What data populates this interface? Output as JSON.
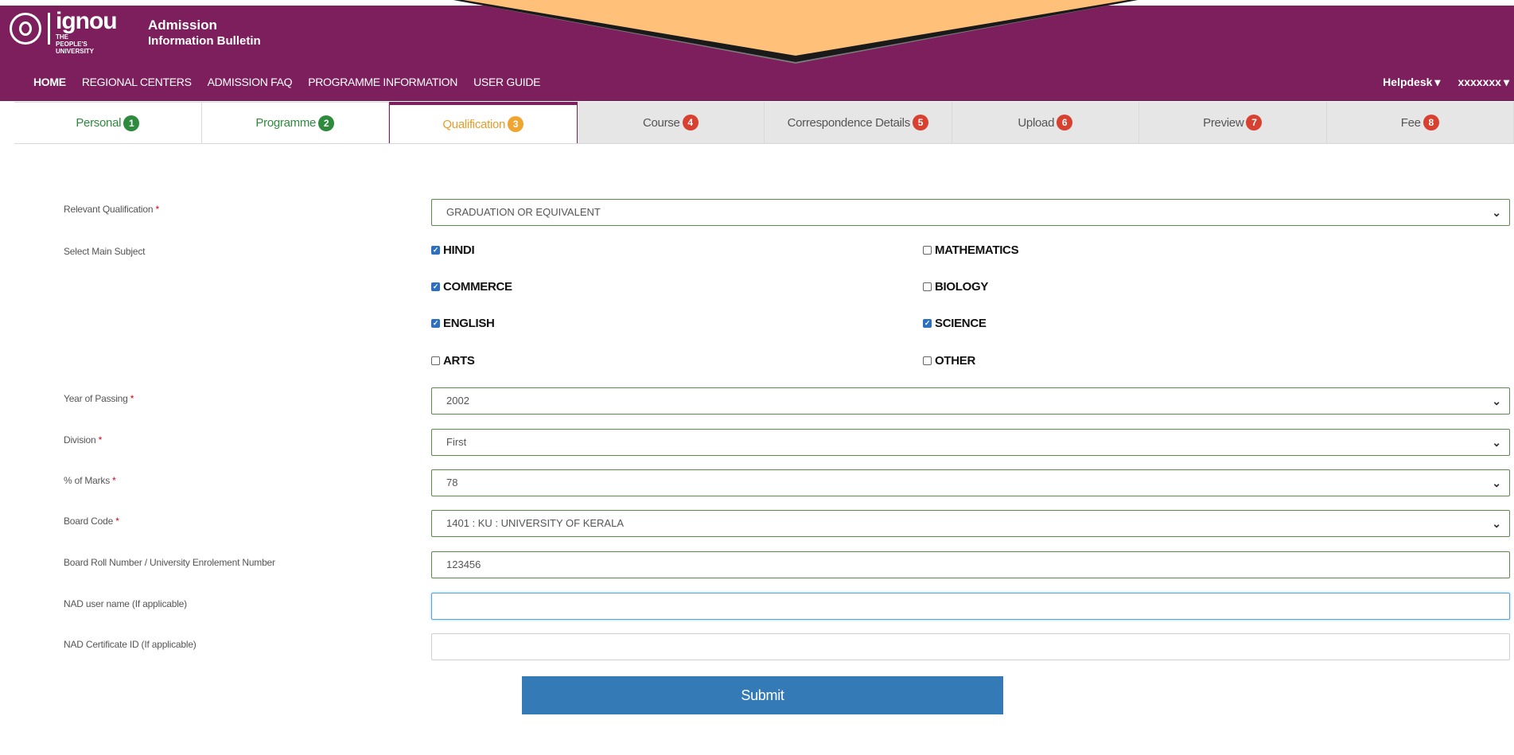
{
  "header": {
    "logo_word": "ignou",
    "logo_sub": "THE PEOPLE'S UNIVERSITY",
    "title_line1": "Admission",
    "title_line2": "Information Bulletin",
    "accent_color": "#7d1f5c"
  },
  "nav": {
    "items": [
      "HOME",
      "REGIONAL CENTERS",
      "ADMISSION FAQ",
      "PROGRAMME INFORMATION",
      "USER GUIDE"
    ],
    "helpdesk": "Helpdesk",
    "user": "xxxxxxx"
  },
  "tabs": [
    {
      "label": "Personal",
      "num": "1",
      "state": "done"
    },
    {
      "label": "Programme",
      "num": "2",
      "state": "done"
    },
    {
      "label": "Qualification",
      "num": "3",
      "state": "active"
    },
    {
      "label": "Course",
      "num": "4",
      "state": "todo"
    },
    {
      "label": "Correspondence Details",
      "num": "5",
      "state": "todo"
    },
    {
      "label": "Upload",
      "num": "6",
      "state": "todo"
    },
    {
      "label": "Preview",
      "num": "7",
      "state": "todo"
    },
    {
      "label": "Fee",
      "num": "8",
      "state": "todo"
    }
  ],
  "form": {
    "relevant_qualification": {
      "label": "Relevant Qualification",
      "value": "GRADUATION OR EQUIVALENT"
    },
    "main_subject": {
      "label": "Select Main Subject",
      "options": [
        {
          "label": "HINDI",
          "checked": true
        },
        {
          "label": "MATHEMATICS",
          "checked": false
        },
        {
          "label": "COMMERCE",
          "checked": true
        },
        {
          "label": "BIOLOGY",
          "checked": false
        },
        {
          "label": "ENGLISH",
          "checked": true
        },
        {
          "label": "SCIENCE",
          "checked": true
        },
        {
          "label": "ARTS",
          "checked": false
        },
        {
          "label": "OTHER",
          "checked": false
        }
      ]
    },
    "year_of_passing": {
      "label": "Year of Passing",
      "value": "2002"
    },
    "division": {
      "label": "Division",
      "value": "First"
    },
    "percent_marks": {
      "label": "% of Marks",
      "value": "78"
    },
    "board_code": {
      "label": "Board Code",
      "value": "1401 : KU : UNIVERSITY OF KERALA"
    },
    "roll_number": {
      "label": "Board Roll Number / University Enrolement Number",
      "value": "123456"
    },
    "nad_user": {
      "label": "NAD user name (If applicable)",
      "value": ""
    },
    "nad_cert": {
      "label": "NAD Certificate ID (If applicable)",
      "value": ""
    },
    "submit_label": "Submit",
    "required_mark": "*"
  }
}
